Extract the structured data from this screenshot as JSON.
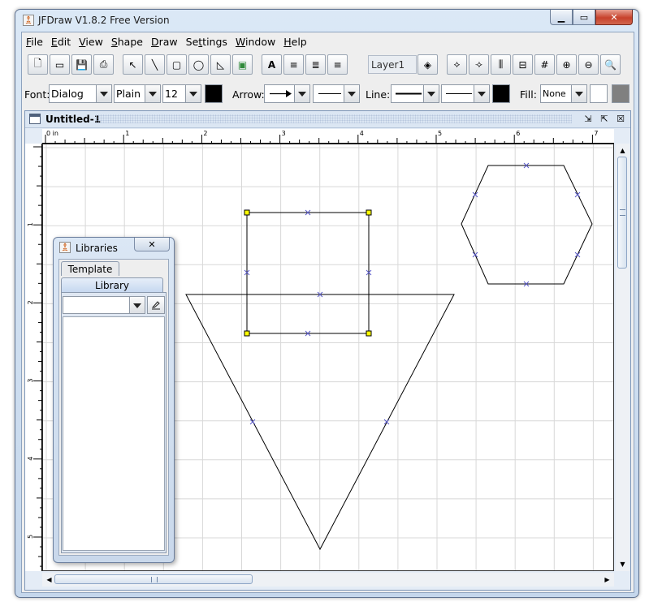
{
  "window": {
    "title": "JFDraw V1.8.2 Free Version"
  },
  "menu": [
    {
      "label": "File",
      "key": "F",
      "rest": "ile"
    },
    {
      "label": "Edit",
      "key": "E",
      "rest": "dit"
    },
    {
      "label": "View",
      "key": "V",
      "rest": "iew"
    },
    {
      "label": "Shape",
      "key": "S",
      "rest": "hape"
    },
    {
      "label": "Draw",
      "key": "D",
      "rest": "raw"
    },
    {
      "label": "Settings",
      "key": "",
      "pre": "Se",
      "key2": "t",
      "rest": "tings"
    },
    {
      "label": "Window",
      "key": "W",
      "rest": "indow"
    },
    {
      "label": "Help",
      "key": "H",
      "rest": "elp"
    }
  ],
  "toolbar": {
    "layer": "Layer1",
    "icons": [
      "new-file-icon",
      "open-icon",
      "save-icon",
      "print-icon",
      "select-arrow-icon",
      "line-icon",
      "rectangle-icon",
      "ellipse-icon",
      "polygon-icon",
      "image-icon",
      "text-icon",
      "align-left-icon",
      "align-justify-icon",
      "align-center-icon",
      "layer-icon",
      "group-icon",
      "ungroup-icon",
      "align-horizontal-icon",
      "align-vertical-icon",
      "grid-icon",
      "zoom-in-icon",
      "zoom-out-icon",
      "zoom-icon"
    ]
  },
  "format": {
    "font_label": "Font:",
    "font_name": "Dialog",
    "font_style": "Plain",
    "font_size": "12",
    "arrow_label": "Arrow:",
    "line_label": "Line:",
    "fill_label": "Fill:",
    "fill_value": "None",
    "font_color": "#000000",
    "line_color": "#000000",
    "fill_color": "#ffffff",
    "extra_color": "#808080"
  },
  "document": {
    "title": "Untitled-1",
    "ruler_unit": "0 in",
    "ruler_top_labels": [
      "1",
      "2",
      "3",
      "4",
      "5",
      "6",
      "7"
    ],
    "ruler_left_labels": [
      "1",
      "2",
      "3",
      "4",
      "5"
    ]
  },
  "libraries": {
    "title": "Libraries",
    "tab_template": "Template",
    "tab_library": "Library",
    "selected": ""
  },
  "colors": {
    "handle_fill": "#ffff00",
    "marker": "#5a5ac8",
    "grid": "#d8d8d8"
  }
}
